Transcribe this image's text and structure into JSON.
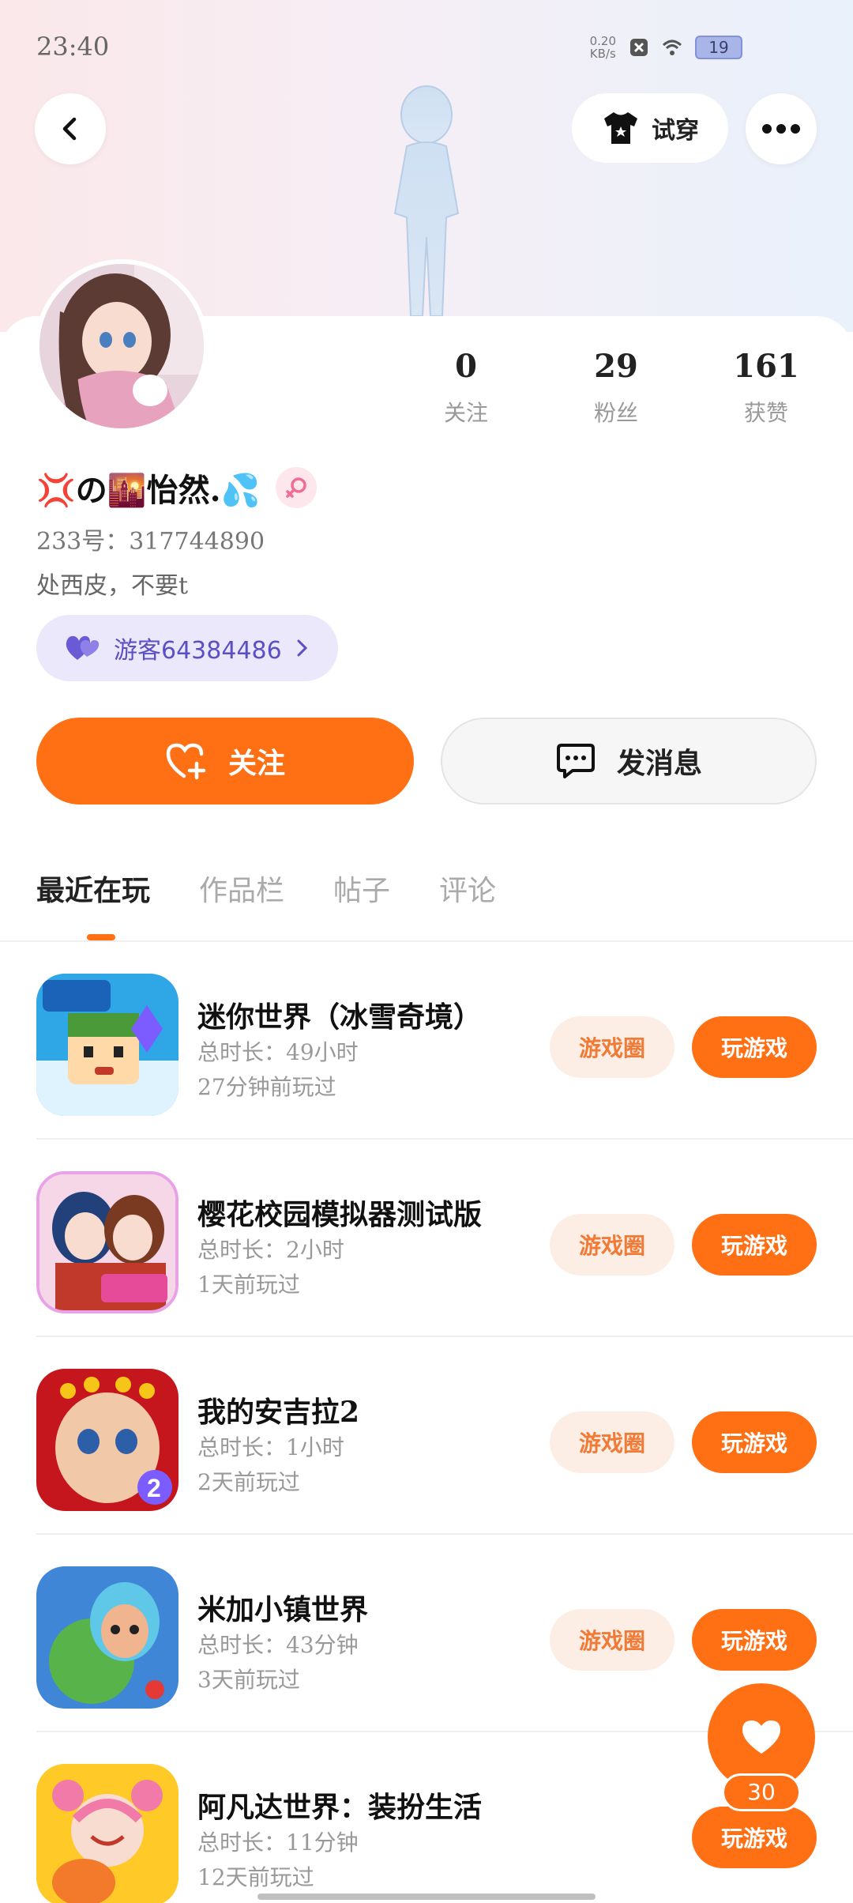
{
  "status_bar": {
    "time": "23:40",
    "net_speed_value": "0.20",
    "net_speed_unit": "KB/s",
    "battery": "19"
  },
  "header": {
    "try_on_label": "试穿"
  },
  "profile": {
    "stats": [
      {
        "value": "0",
        "label": "关注"
      },
      {
        "value": "29",
        "label": "粉丝"
      },
      {
        "value": "161",
        "label": "获赞"
      }
    ],
    "nickname": "💢の🌇怡然.💦",
    "uid": "233号：317744890",
    "bio": "处西皮，不要t",
    "guest_chip_label": "游客64384486"
  },
  "actions": {
    "follow_label": "关注",
    "message_label": "发消息"
  },
  "tabs": [
    {
      "label": "最近在玩",
      "active": true
    },
    {
      "label": "作品栏",
      "active": false
    },
    {
      "label": "帖子",
      "active": false
    },
    {
      "label": "评论",
      "active": false
    }
  ],
  "games": [
    {
      "title": "迷你世界（冰雪奇境）",
      "duration": "总时长：49小时",
      "last_played": "27分钟前玩过",
      "circle_label": "游戏圈",
      "play_label": "玩游戏",
      "show_circle": true
    },
    {
      "title": "樱花校园模拟器测试版",
      "duration": "总时长：2小时",
      "last_played": "1天前玩过",
      "circle_label": "游戏圈",
      "play_label": "玩游戏",
      "show_circle": true
    },
    {
      "title": "我的安吉拉2",
      "duration": "总时长：1小时",
      "last_played": "2天前玩过",
      "circle_label": "游戏圈",
      "play_label": "玩游戏",
      "show_circle": true
    },
    {
      "title": "米加小镇世界",
      "duration": "总时长：43分钟",
      "last_played": "3天前玩过",
      "circle_label": "游戏圈",
      "play_label": "玩游戏",
      "show_circle": true
    },
    {
      "title": "阿凡达世界：装扮生活",
      "duration": "总时长：11分钟",
      "last_played": "12天前玩过",
      "circle_label": "",
      "play_label": "玩游戏",
      "show_circle": false
    }
  ],
  "fab": {
    "count": "30"
  },
  "colors": {
    "accent": "#ff6f14",
    "accent_soft": "#fdeee5",
    "guest_chip": "#ebe8fb"
  }
}
